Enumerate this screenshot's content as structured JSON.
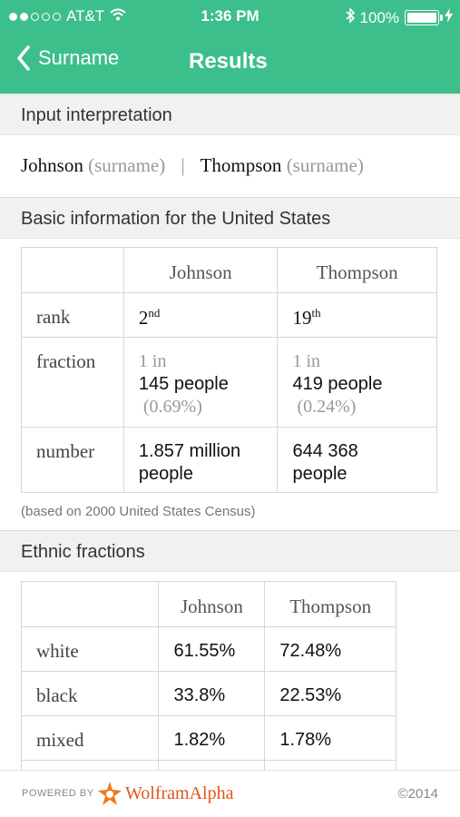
{
  "status_bar": {
    "carrier": "AT&T",
    "time": "1:36 PM",
    "battery": "100%"
  },
  "nav": {
    "back_label": "Surname",
    "title": "Results"
  },
  "input_interpretation": {
    "header": "Input interpretation",
    "name1": "Johnson",
    "type1": "(surname)",
    "separator": "|",
    "name2": "Thompson",
    "type2": "(surname)"
  },
  "basic_info": {
    "header": "Basic information for the United States",
    "columns": [
      "Johnson",
      "Thompson"
    ],
    "rank": {
      "label": "rank",
      "johnson": "2",
      "johnson_suffix": "nd",
      "thompson": "19",
      "thompson_suffix": "th"
    },
    "fraction": {
      "label": "fraction",
      "johnson_prefix": "1 in",
      "johnson_value": "145 people",
      "johnson_percent": "(0.69%)",
      "thompson_prefix": "1 in",
      "thompson_value": "419 people",
      "thompson_percent": "(0.24%)"
    },
    "number": {
      "label": "number",
      "johnson_line1": "1.857 million",
      "johnson_line2": "people",
      "thompson_line1": "644 368",
      "thompson_line2": "people"
    },
    "note": "(based on 2000 United States Census)"
  },
  "ethnic": {
    "header": "Ethnic fractions",
    "columns": [
      "Johnson",
      "Thompson"
    ],
    "rows": [
      {
        "label": "white",
        "johnson": "61.55%",
        "thompson": "72.48%"
      },
      {
        "label": "black",
        "johnson": "33.8%",
        "thompson": "22.53%"
      },
      {
        "label": "mixed",
        "johnson": "1.82%",
        "thompson": "1.78%"
      }
    ]
  },
  "footer": {
    "powered_by": "POWERED BY",
    "brand": "WolframAlpha",
    "copyright": "©2014"
  },
  "colors": {
    "header_green": "#3dbf8c",
    "brand_orange": "#e0561b"
  }
}
